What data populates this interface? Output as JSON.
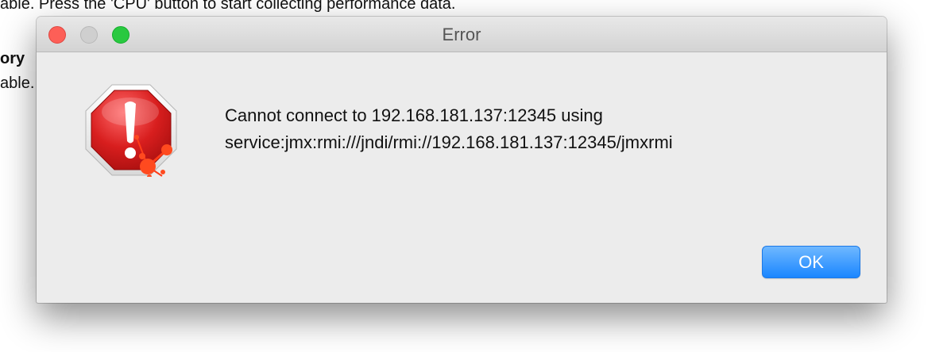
{
  "background": {
    "lines": [
      "able. Press the 'CPU' button to start collecting performance data.",
      "ory",
      "able."
    ]
  },
  "dialog": {
    "title": "Error",
    "message_line1": "Cannot connect to 192.168.181.137:12345 using",
    "message_line2": "service:jmx:rmi:///jndi/rmi://192.168.181.137:12345/jmxrmi",
    "ok_label": "OK",
    "icon": "error-stop-icon"
  },
  "colors": {
    "close": "#fd5f57",
    "minimize": "#cfcfcf",
    "zoom": "#29c940",
    "ok_button": "#1a86ff",
    "error_red": "#d81e1e"
  }
}
